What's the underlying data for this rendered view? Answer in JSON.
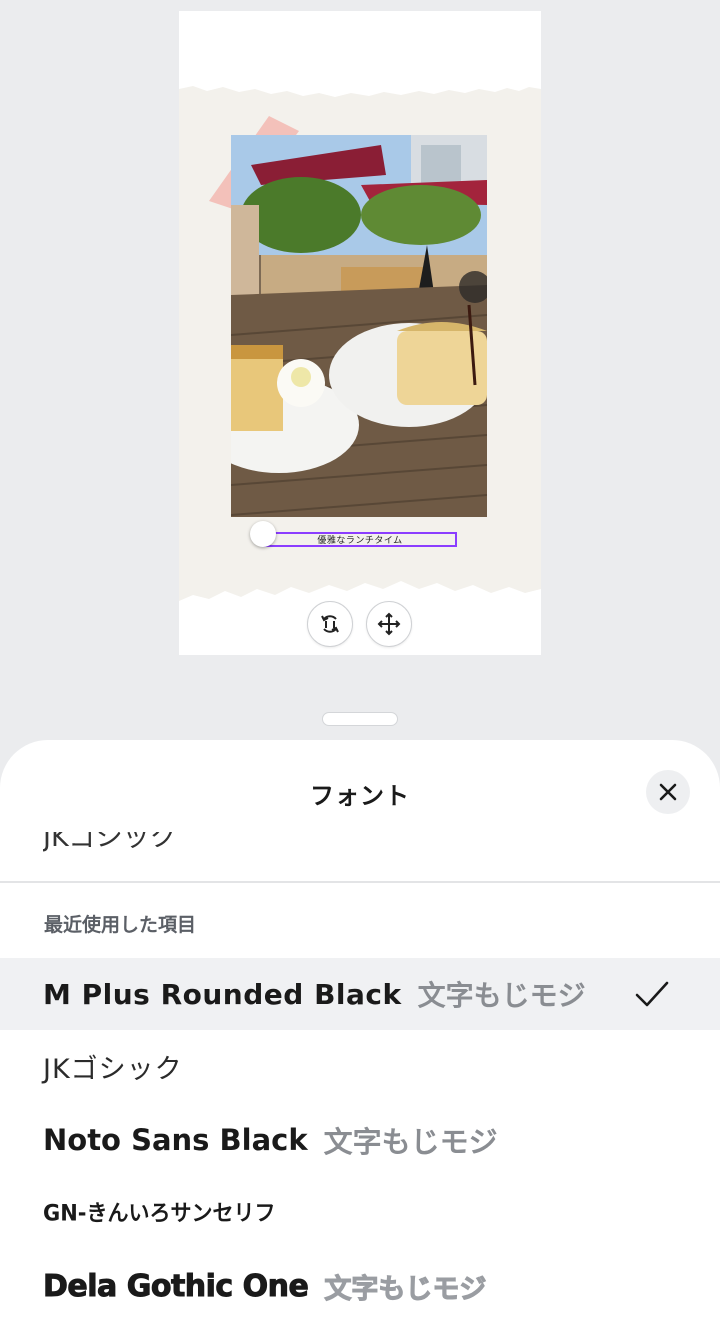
{
  "canvas": {
    "caption": "優雅なランチタイム"
  },
  "sheet": {
    "title": "フォント",
    "partial_item": "JKゴシック",
    "section_label": "最近使用した項目",
    "fonts": [
      {
        "name": "M Plus Rounded Black",
        "sample": "文字もじモジ",
        "selected": true
      },
      {
        "name": "JKゴシック",
        "sample": "",
        "selected": false
      },
      {
        "name": "Noto Sans Black",
        "sample": "文字もじモジ",
        "selected": false
      },
      {
        "name": "GN-きんいろサンセリフ",
        "sample": "",
        "selected": false
      },
      {
        "name": "Dela Gothic One",
        "sample": "文字もじモジ",
        "selected": false
      }
    ]
  },
  "colors": {
    "selection_outline": "#8b3dff",
    "sheet_background": "#ffffff",
    "selected_row": "#f0f1f3",
    "canvas_background": "#ebecee"
  },
  "icons": [
    "rotate-icon",
    "move-icon",
    "close-icon",
    "checkmark-icon"
  ]
}
